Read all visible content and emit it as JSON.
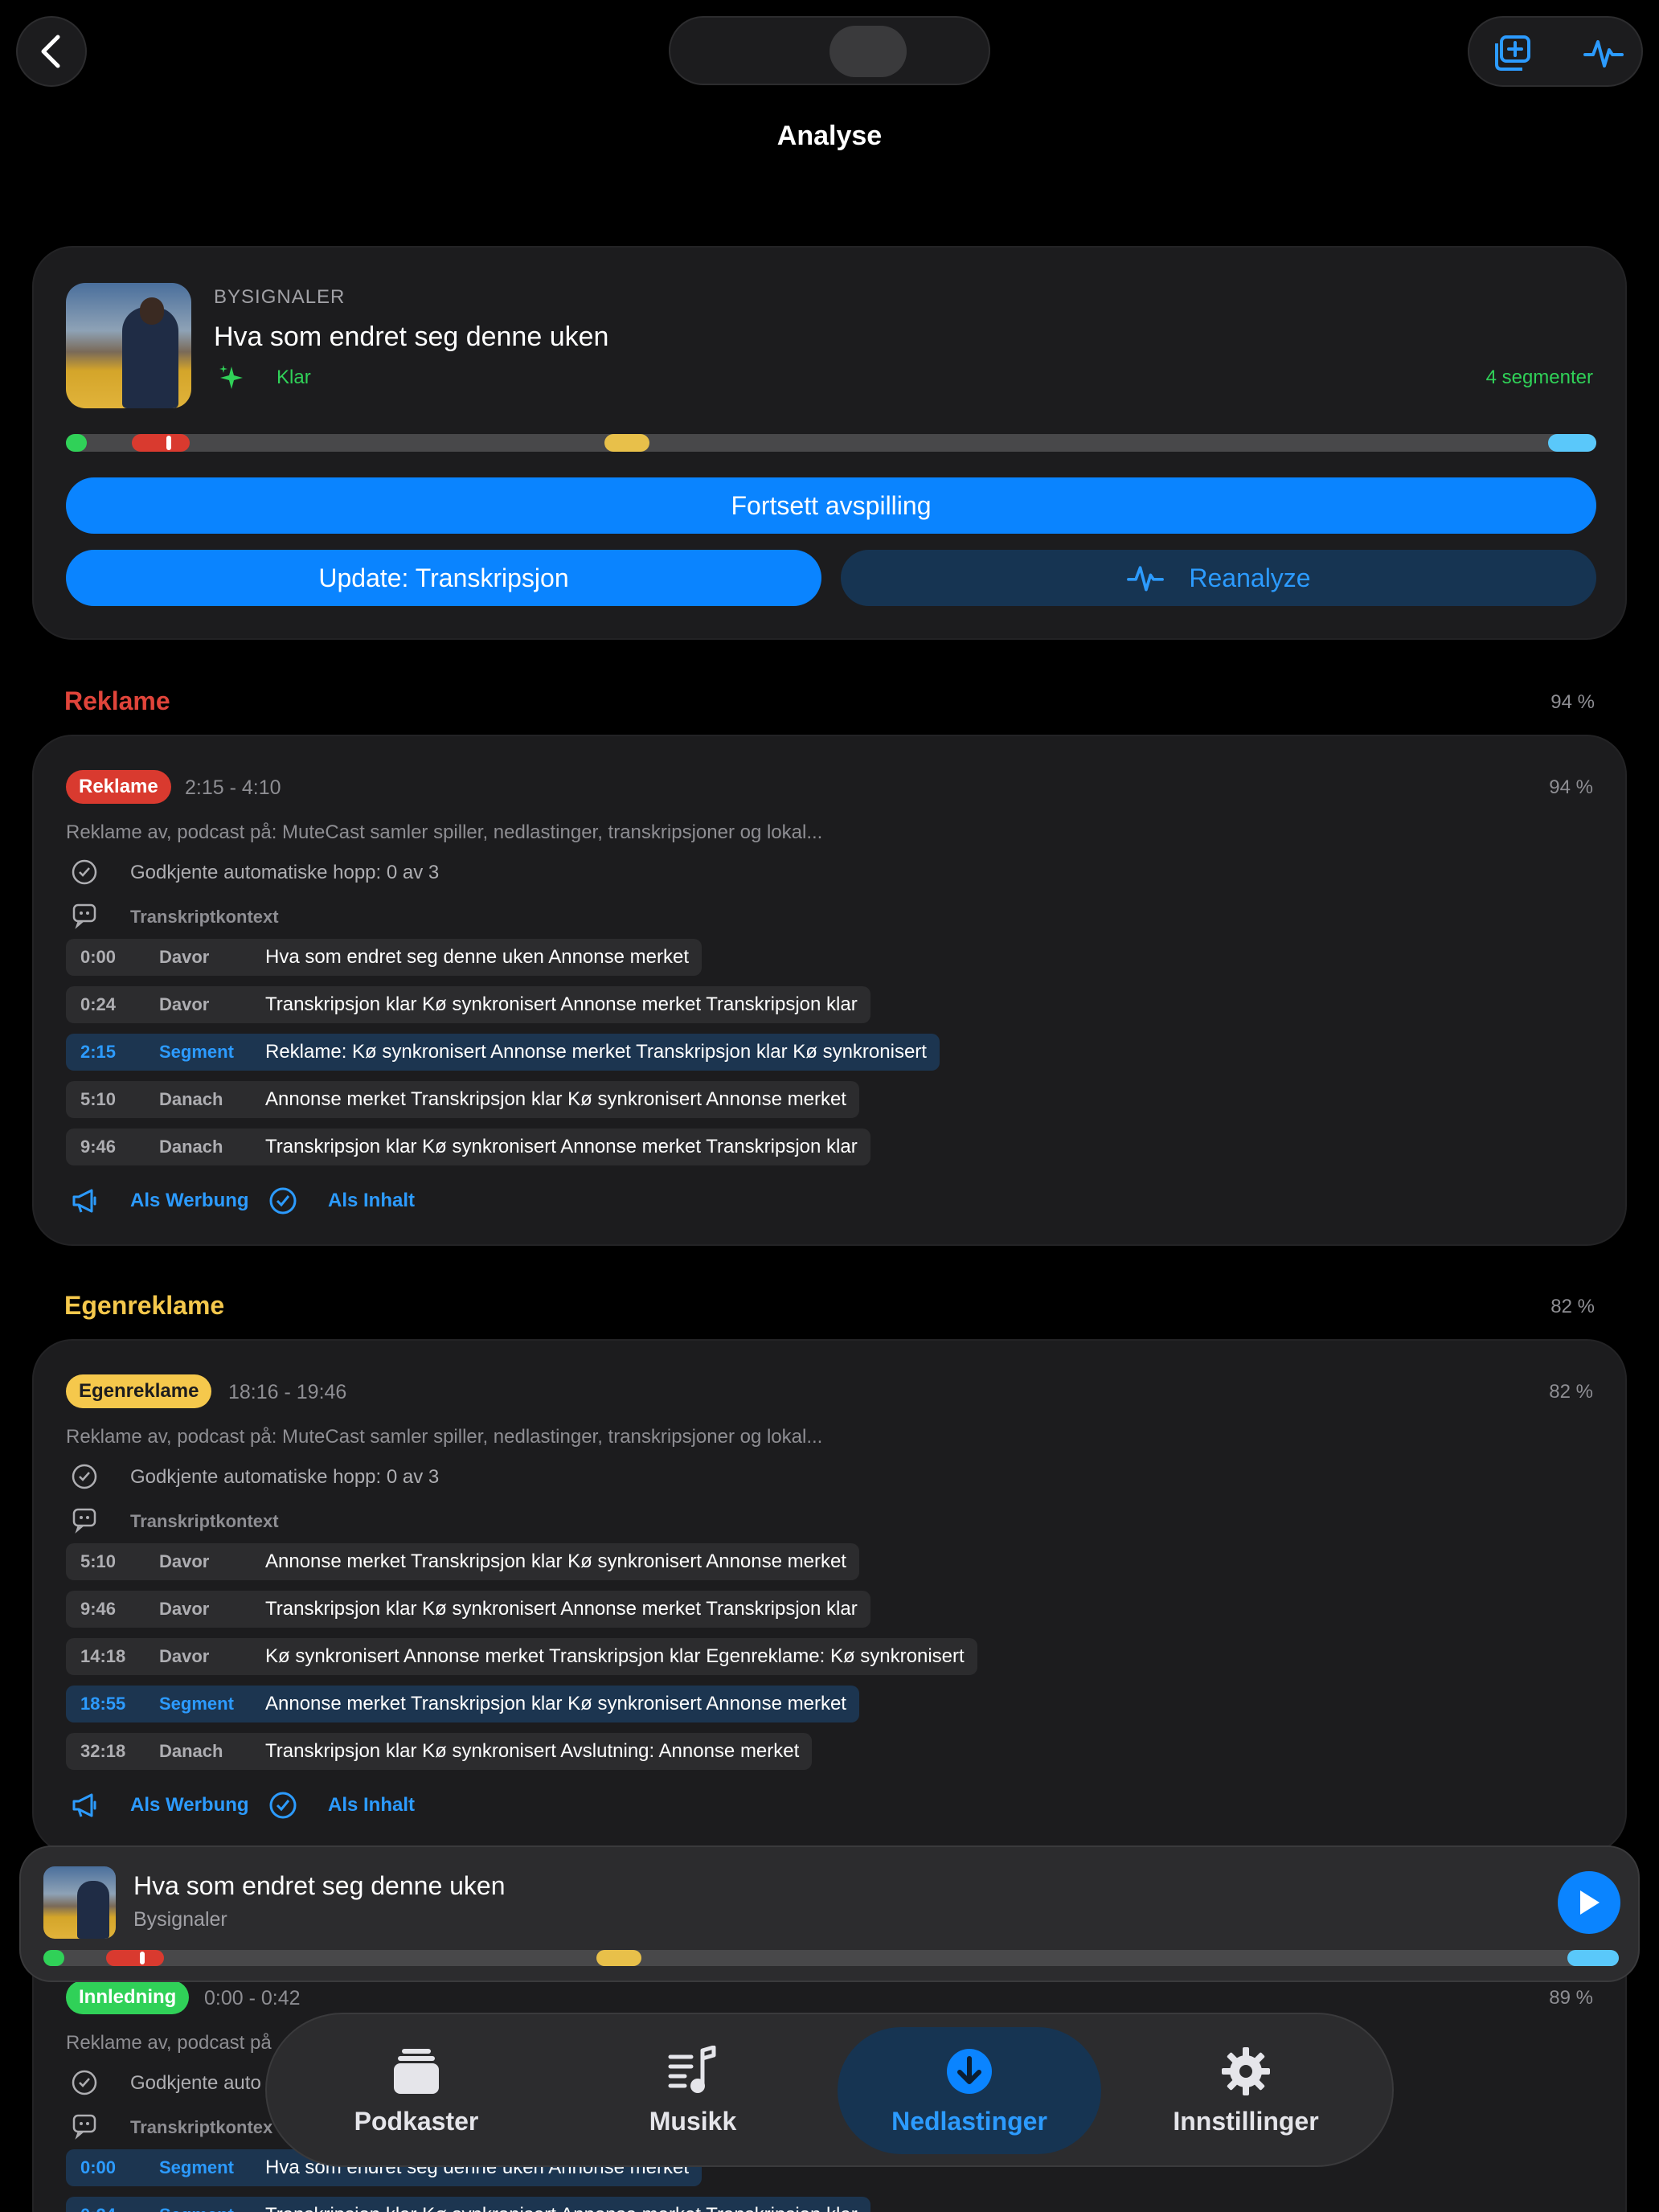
{
  "header": {
    "title": "Analyse"
  },
  "episode": {
    "show": "BYSIGNALER",
    "title": "Hva som endret seg denne uken",
    "status": "Klar",
    "segment_count": "4 segmenter",
    "continue_label": "Fortsett avspilling",
    "update_label": "Update: Transkripsjon",
    "reanalyze_label": "Reanalyze"
  },
  "sections": [
    {
      "heading": "Reklame",
      "heading_pct": "94 %",
      "badge": "Reklame",
      "range": "2:15 - 4:10",
      "pct": "94 %",
      "desc": "Reklame av, podcast på: MuteCast samler spiller, nedlastinger, transkripsjoner og lokal...",
      "approval": "Godkjente automatiske hopp: 0 av 3",
      "context_label": "Transkriptkontext",
      "lines": [
        {
          "t": "0:00",
          "p": "Davor",
          "x": "Hva som endret seg denne uken Annonse merket"
        },
        {
          "t": "0:24",
          "p": "Davor",
          "x": "Transkripsjon klar Kø synkronisert Annonse merket Transkripsjon klar"
        },
        {
          "t": "2:15",
          "p": "Segment",
          "x": "Reklame: Kø synkronisert Annonse merket Transkripsjon klar Kø synkronisert"
        },
        {
          "t": "5:10",
          "p": "Danach",
          "x": "Annonse merket Transkripsjon klar Kø synkronisert Annonse merket"
        },
        {
          "t": "9:46",
          "p": "Danach",
          "x": "Transkripsjon klar Kø synkronisert Annonse merket Transkripsjon klar"
        }
      ],
      "as_ad": "Als Werbung",
      "as_content": "Als Inhalt"
    },
    {
      "heading": "Egenreklame",
      "heading_pct": "82 %",
      "badge": "Egenreklame",
      "range": "18:16 - 19:46",
      "pct": "82 %",
      "desc": "Reklame av, podcast på: MuteCast samler spiller, nedlastinger, transkripsjoner og lokal...",
      "approval": "Godkjente automatiske hopp: 0 av 3",
      "context_label": "Transkriptkontext",
      "lines": [
        {
          "t": "5:10",
          "p": "Davor",
          "x": "Annonse merket Transkripsjon klar Kø synkronisert Annonse merket"
        },
        {
          "t": "9:46",
          "p": "Davor",
          "x": "Transkripsjon klar Kø synkronisert Annonse merket Transkripsjon klar"
        },
        {
          "t": "14:18",
          "p": "Davor",
          "x": "Kø synkronisert Annonse merket Transkripsjon klar Egenreklame: Kø synkronisert"
        },
        {
          "t": "18:55",
          "p": "Segment",
          "x": "Annonse merket Transkripsjon klar Kø synkronisert Annonse merket"
        },
        {
          "t": "32:18",
          "p": "Danach",
          "x": "Transkripsjon klar Kø synkronisert Avslutning: Annonse merket"
        }
      ],
      "as_ad": "Als Werbung",
      "as_content": "Als Inhalt"
    },
    {
      "badge": "Innledning",
      "range": "0:00 - 0:42",
      "pct": "89 %",
      "desc": "Reklame av, podcast på",
      "approval": "Godkjente auto",
      "context_label": "Transkriptkontex",
      "lines": [
        {
          "t": "0:00",
          "p": "Segment",
          "x": "Hva som endret seg denne uken Annonse merket"
        },
        {
          "t": "0:24",
          "p": "Segment",
          "x": "Transkripsjon klar Kø synkronisert Annonse merket Transkripsjon klar"
        }
      ]
    }
  ],
  "mini_player": {
    "title": "Hva som endret seg denne uken",
    "subtitle": "Bysignaler"
  },
  "tabs": [
    {
      "label": "Podkaster",
      "icon": "stack-icon"
    },
    {
      "label": "Musikk",
      "icon": "music-list-icon"
    },
    {
      "label": "Nedlastinger",
      "icon": "download-icon"
    },
    {
      "label": "Innstillinger",
      "icon": "gear-icon"
    }
  ],
  "colors": {
    "accent": "#0a84ff",
    "ad": "#d93a2f",
    "self_promo": "#f5c84c",
    "intro": "#30d158",
    "outro": "#5ac8fa"
  }
}
